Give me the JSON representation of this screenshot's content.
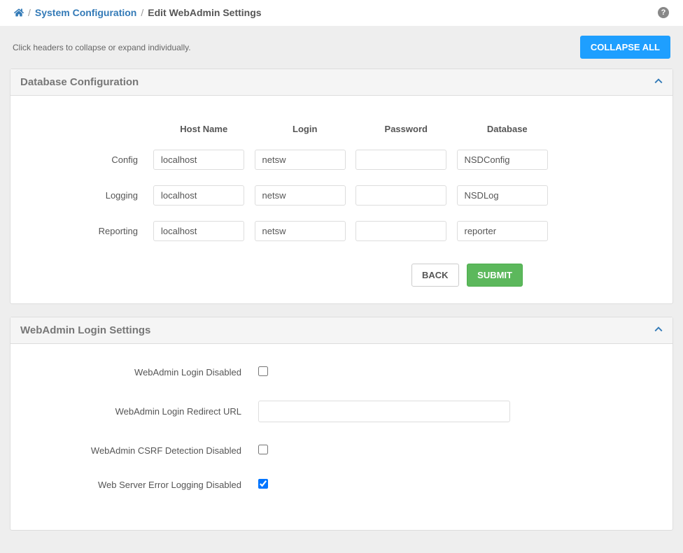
{
  "breadcrumb": {
    "home_aria": "Home",
    "link1": "System Configuration",
    "current": "Edit WebAdmin Settings"
  },
  "hint_text": "Click headers to collapse or expand individually.",
  "collapse_all_label": "COLLAPSE ALL",
  "panel1": {
    "title": "Database Configuration",
    "headers": {
      "host": "Host Name",
      "login": "Login",
      "password": "Password",
      "database": "Database"
    },
    "rows": {
      "config": {
        "label": "Config",
        "host": "localhost",
        "login": "netsw",
        "password": "",
        "database": "NSDConfig"
      },
      "logging": {
        "label": "Logging",
        "host": "localhost",
        "login": "netsw",
        "password": "",
        "database": "NSDLog"
      },
      "reporting": {
        "label": "Reporting",
        "host": "localhost",
        "login": "netsw",
        "password": "",
        "database": "reporter"
      }
    },
    "back_label": "BACK",
    "submit_label": "SUBMIT"
  },
  "panel2": {
    "title": "WebAdmin Login Settings",
    "fields": {
      "login_disabled": {
        "label": "WebAdmin Login Disabled",
        "checked": false
      },
      "redirect_url": {
        "label": "WebAdmin Login Redirect URL",
        "value": ""
      },
      "csrf_disabled": {
        "label": "WebAdmin CSRF Detection Disabled",
        "checked": false
      },
      "error_logging_disabled": {
        "label": "Web Server Error Logging Disabled",
        "checked": true
      }
    }
  }
}
